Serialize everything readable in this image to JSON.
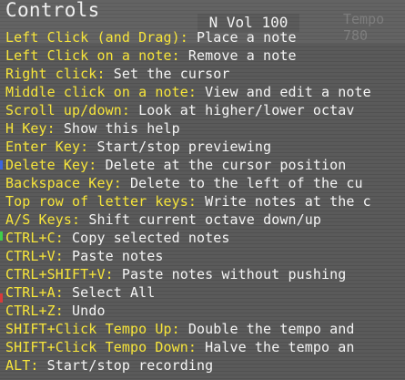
{
  "title": "Controls",
  "volume_display": "N Vol 100",
  "tempo": {
    "label": "Tempo",
    "value": "780"
  },
  "colors": {
    "key": "#f7e53a",
    "desc": "#f5f5f5",
    "background": "#5a5a5a"
  },
  "controls": [
    {
      "key": "Left Click (and Drag):",
      "desc": " Place a note"
    },
    {
      "key": "Left Click on a note:",
      "desc": " Remove a note"
    },
    {
      "key": "Right click:",
      "desc": " Set the cursor"
    },
    {
      "key": "Middle click on a note:",
      "desc": " View and edit a note"
    },
    {
      "key": "Scroll up/down:",
      "desc": " Look at higher/lower octav"
    },
    {
      "key": "H Key:",
      "desc": " Show this help"
    },
    {
      "key": "Enter Key:",
      "desc": " Start/stop previewing"
    },
    {
      "key": "Delete Key:",
      "desc": " Delete at the cursor position"
    },
    {
      "key": "Backspace Key:",
      "desc": " Delete to the left of the cu"
    },
    {
      "key": "Top row of letter keys:",
      "desc": " Write notes at the c"
    },
    {
      "key": "A/S Keys:",
      "desc": " Shift current octave down/up"
    },
    {
      "key": "CTRL+C:",
      "desc": " Copy selected notes"
    },
    {
      "key": "CTRL+V:",
      "desc": " Paste notes"
    },
    {
      "key": "CTRL+SHIFT+V:",
      "desc": " Paste notes without pushing"
    },
    {
      "key": "CTRL+A:",
      "desc": " Select All"
    },
    {
      "key": "CTRL+Z:",
      "desc": " Undo"
    },
    {
      "key": "SHIFT+Click Tempo Up:",
      "desc": " Double the tempo and"
    },
    {
      "key": "SHIFT+Click Tempo Down:",
      "desc": " Halve the tempo an"
    },
    {
      "key": "ALT:",
      "desc": " Start/stop recording"
    }
  ]
}
